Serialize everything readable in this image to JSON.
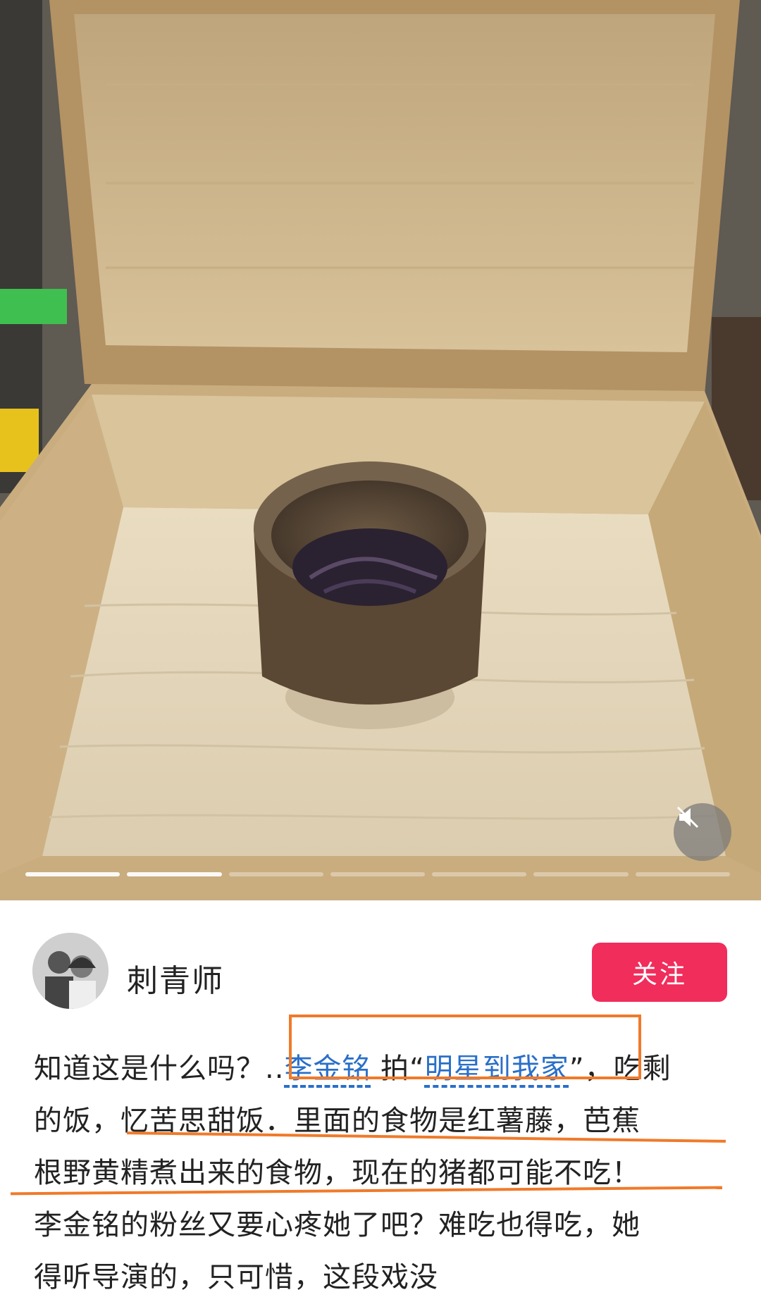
{
  "media": {
    "description_icon": "mute-icon",
    "slides_total": 7,
    "slides_viewed": 2
  },
  "author": {
    "name": "刺青师",
    "follow_label": "关注"
  },
  "post": {
    "line1_prefix": "知道这是什么吗？",
    "line1_ellipsis": "..",
    "line1_mention": "李金铭",
    "line1_mid": " 拍“",
    "line1_show": "明星到我家",
    "line1_suffix": "”，吃剩",
    "line2": "的饭，忆苦思甜饭．里面的食物是红薯藤，芭蕉",
    "line3": "根野黄精煮出来的食物，现在的猪都可能不吃！",
    "line4": "李金铭的粉丝又要心疼她了吧？难吃也得吃，她",
    "line5": "得听导演的，只可惜，这段戏没"
  },
  "colors": {
    "follow_bg": "#f02d5b",
    "link": "#2a6fc9",
    "annotation": "#f07a2a"
  }
}
